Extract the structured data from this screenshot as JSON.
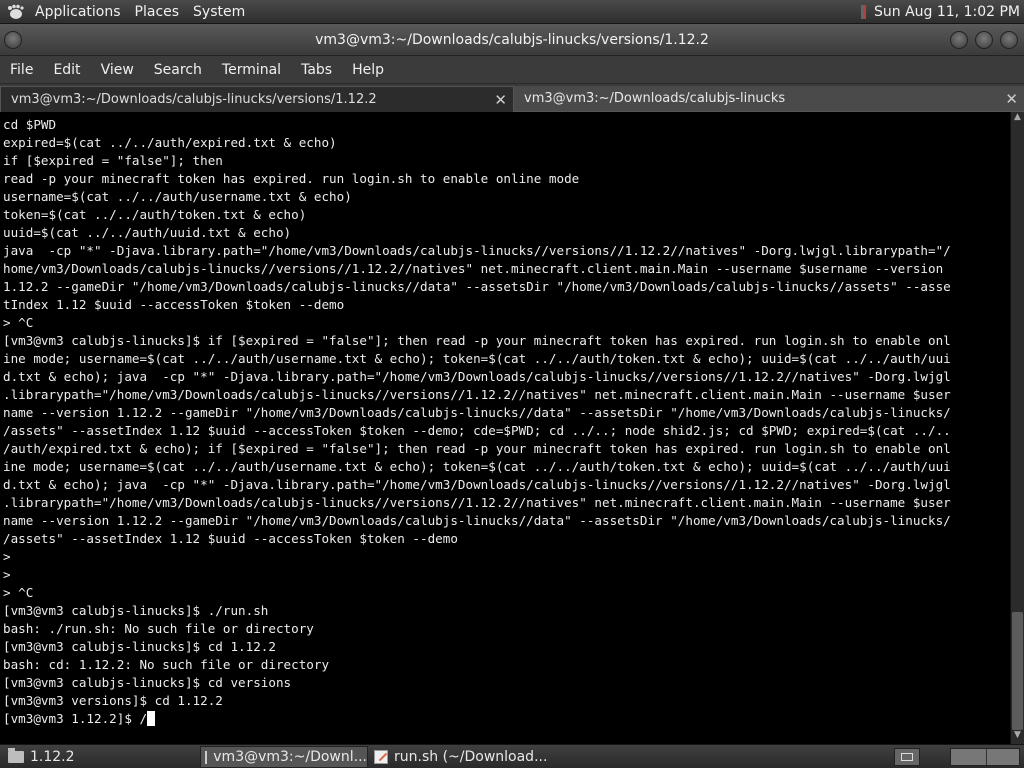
{
  "top_panel": {
    "menus": [
      "Applications",
      "Places",
      "System"
    ],
    "clock": "Sun Aug 11,  1:02 PM"
  },
  "window": {
    "title": "vm3@vm3:~/Downloads/calubjs-linucks/versions/1.12.2"
  },
  "menubar": [
    "File",
    "Edit",
    "View",
    "Search",
    "Terminal",
    "Tabs",
    "Help"
  ],
  "tabs": [
    {
      "label": "vm3@vm3:~/Downloads/calubjs-linucks/versions/1.12.2",
      "close": "✕",
      "active": true
    },
    {
      "label": "vm3@vm3:~/Downloads/calubjs-linucks",
      "close": "✕",
      "active": false
    }
  ],
  "terminal": {
    "lines": [
      "cd $PWD",
      "expired=$(cat ../../auth/expired.txt & echo)",
      "if [$expired = \"false\"]; then",
      "read -p your minecraft token has expired. run login.sh to enable online mode",
      "username=$(cat ../../auth/username.txt & echo)",
      "token=$(cat ../../auth/token.txt & echo)",
      "uuid=$(cat ../../auth/uuid.txt & echo)",
      "java  -cp \"*\" -Djava.library.path=\"/home/vm3/Downloads/calubjs-linucks//versions//1.12.2//natives\" -Dorg.lwjgl.librarypath=\"/",
      "home/vm3/Downloads/calubjs-linucks//versions//1.12.2//natives\" net.minecraft.client.main.Main --username $username --version",
      "1.12.2 --gameDir \"/home/vm3/Downloads/calubjs-linucks//data\" --assetsDir \"/home/vm3/Downloads/calubjs-linucks//assets\" --asse",
      "tIndex 1.12 $uuid --accessToken $token --demo",
      "> ^C",
      "[vm3@vm3 calubjs-linucks]$ if [$expired = \"false\"]; then read -p your minecraft token has expired. run login.sh to enable onl",
      "ine mode; username=$(cat ../../auth/username.txt & echo); token=$(cat ../../auth/token.txt & echo); uuid=$(cat ../../auth/uui",
      "d.txt & echo); java  -cp \"*\" -Djava.library.path=\"/home/vm3/Downloads/calubjs-linucks//versions//1.12.2//natives\" -Dorg.lwjgl",
      ".librarypath=\"/home/vm3/Downloads/calubjs-linucks//versions//1.12.2//natives\" net.minecraft.client.main.Main --username $user",
      "name --version 1.12.2 --gameDir \"/home/vm3/Downloads/calubjs-linucks//data\" --assetsDir \"/home/vm3/Downloads/calubjs-linucks/",
      "/assets\" --assetIndex 1.12 $uuid --accessToken $token --demo; cde=$PWD; cd ../..; node shid2.js; cd $PWD; expired=$(cat ../..",
      "/auth/expired.txt & echo); if [$expired = \"false\"]; then read -p your minecraft token has expired. run login.sh to enable onl",
      "ine mode; username=$(cat ../../auth/username.txt & echo); token=$(cat ../../auth/token.txt & echo); uuid=$(cat ../../auth/uui",
      "d.txt & echo); java  -cp \"*\" -Djava.library.path=\"/home/vm3/Downloads/calubjs-linucks//versions//1.12.2//natives\" -Dorg.lwjgl",
      ".librarypath=\"/home/vm3/Downloads/calubjs-linucks//versions//1.12.2//natives\" net.minecraft.client.main.Main --username $user",
      "name --version 1.12.2 --gameDir \"/home/vm3/Downloads/calubjs-linucks//data\" --assetsDir \"/home/vm3/Downloads/calubjs-linucks/",
      "/assets\" --assetIndex 1.12 $uuid --accessToken $token --demo",
      ">",
      ">",
      "> ^C",
      "[vm3@vm3 calubjs-linucks]$ ./run.sh",
      "bash: ./run.sh: No such file or directory",
      "[vm3@vm3 calubjs-linucks]$ cd 1.12.2",
      "bash: cd: 1.12.2: No such file or directory",
      "[vm3@vm3 calubjs-linucks]$ cd versions",
      "[vm3@vm3 versions]$ cd 1.12.2"
    ],
    "prompt_line": "[vm3@vm3 1.12.2]$ /"
  },
  "scrollbar": {
    "up": "▲",
    "down": "▼"
  },
  "taskbar": {
    "items": [
      {
        "label": "1.12.2",
        "icon": "folder-icon"
      },
      {
        "label": "vm3@vm3:~/Downl...",
        "icon": "terminal-icon",
        "active": true
      },
      {
        "label": "run.sh (~/Download...",
        "icon": "text-editor-icon"
      }
    ]
  }
}
